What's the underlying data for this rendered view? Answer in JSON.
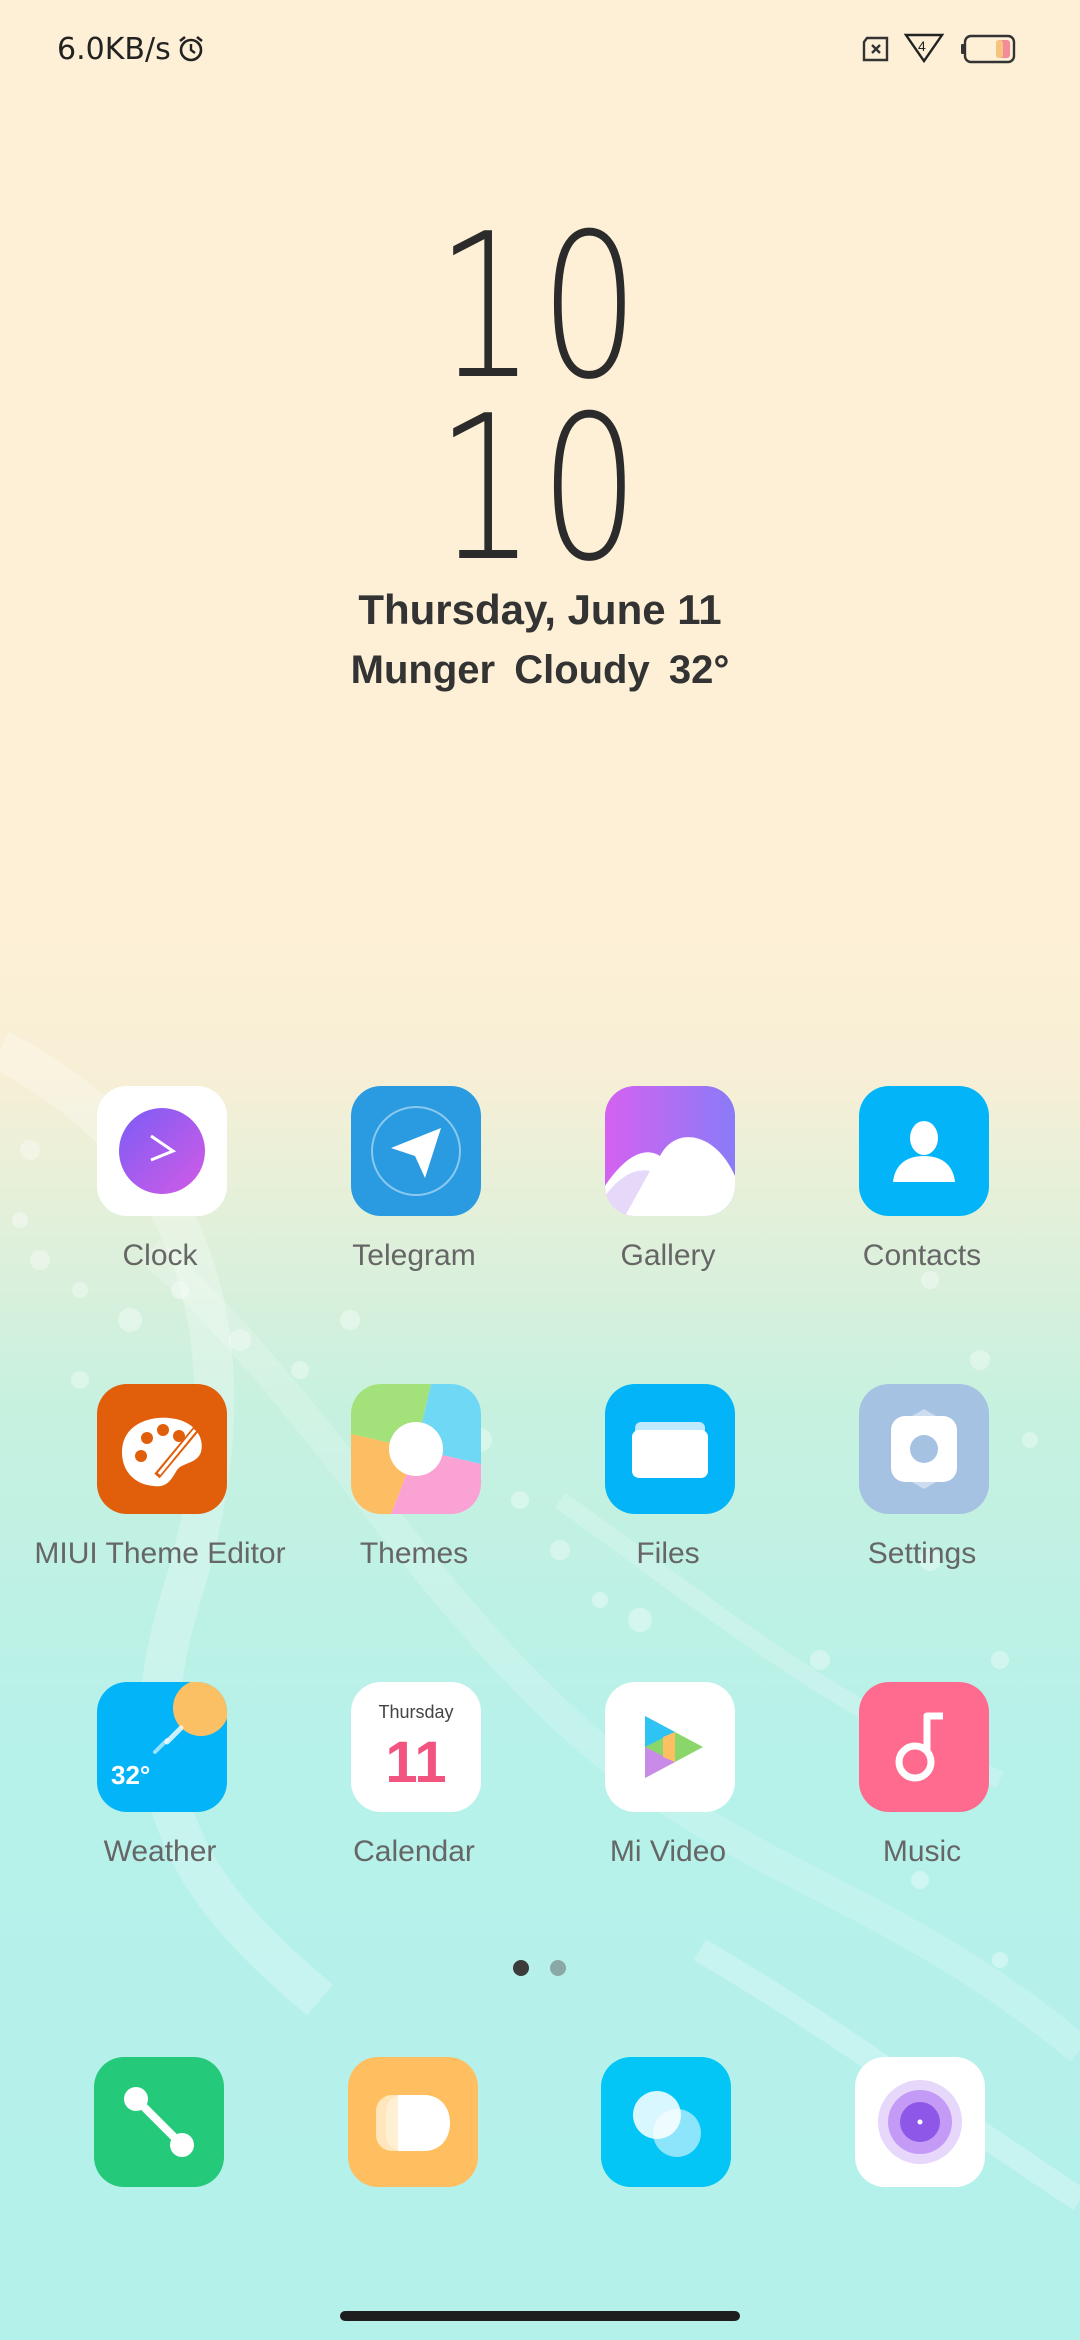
{
  "status_bar": {
    "net_speed": "6.0KB/s",
    "icons": [
      "alarm-icon",
      "sim-icon",
      "signal-4g-icon",
      "battery-icon"
    ],
    "signal_label": "4"
  },
  "clock_widget": {
    "hours": "10",
    "minutes": "10",
    "date": "Thursday, June 11",
    "weather": "Munger  Cloudy  32°"
  },
  "apps": [
    {
      "label": "Clock",
      "icon": "clock-icon"
    },
    {
      "label": "Telegram",
      "icon": "telegram-icon"
    },
    {
      "label": "Gallery",
      "icon": "gallery-icon"
    },
    {
      "label": "Contacts",
      "icon": "contacts-icon"
    },
    {
      "label": "MIUI Theme Editor",
      "icon": "theme-editor-icon"
    },
    {
      "label": "Themes",
      "icon": "themes-icon"
    },
    {
      "label": "Files",
      "icon": "files-icon"
    },
    {
      "label": "Settings",
      "icon": "settings-icon"
    },
    {
      "label": "Weather",
      "icon": "weather-icon",
      "badge": "32°"
    },
    {
      "label": "Calendar",
      "icon": "calendar-icon",
      "day_name": "Thursday",
      "day_number": "11"
    },
    {
      "label": "Mi Video",
      "icon": "mi-video-icon"
    },
    {
      "label": "Music",
      "icon": "music-icon"
    }
  ],
  "dock": [
    {
      "icon": "phone-icon"
    },
    {
      "icon": "messages-icon"
    },
    {
      "icon": "browser-icon"
    },
    {
      "icon": "camera-icon"
    }
  ],
  "pager": {
    "pages": 2,
    "current": 1
  },
  "colors": {
    "clock_purple": "#a45cf2",
    "telegram_blue": "#2a9be0",
    "contacts_blue": "#03b4f9",
    "theme_editor_orange": "#e15f0a",
    "files_blue": "#03b4f9",
    "settings_blue": "#a5c2e2",
    "weather_blue": "#03b4f9",
    "music_pink": "#ff6b8e",
    "phone_green": "#25c97a",
    "messages_orange": "#ffbf60",
    "browser_blue": "#03c6f7"
  }
}
